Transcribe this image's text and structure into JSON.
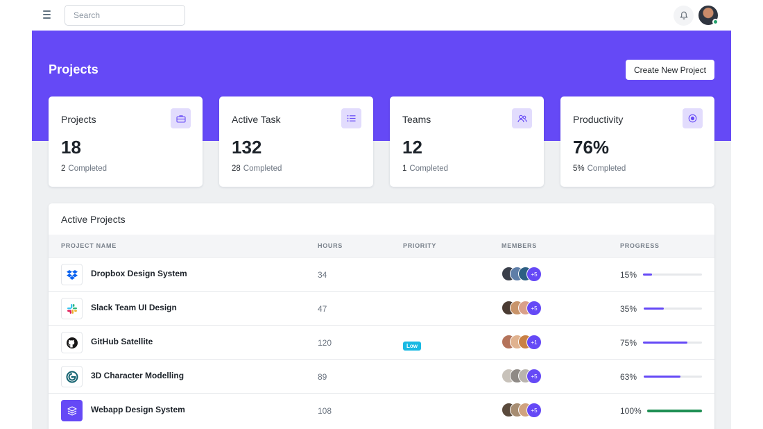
{
  "topbar": {
    "search_placeholder": "Search"
  },
  "header": {
    "title": "Projects",
    "create_button": "Create New Project"
  },
  "stats": [
    {
      "title": "Projects",
      "value": "18",
      "completed_count": "2",
      "completed_label": "Completed",
      "icon": "briefcase-icon"
    },
    {
      "title": "Active Task",
      "value": "132",
      "completed_count": "28",
      "completed_label": "Completed",
      "icon": "list-icon"
    },
    {
      "title": "Teams",
      "value": "12",
      "completed_count": "1",
      "completed_label": "Completed",
      "icon": "users-icon"
    },
    {
      "title": "Productivity",
      "value": "76%",
      "completed_count": "5%",
      "completed_label": "Completed",
      "icon": "target-icon"
    }
  ],
  "table": {
    "title": "Active Projects",
    "columns": [
      "PROJECT NAME",
      "HOURS",
      "PRIORITY",
      "MEMBERS",
      "PROGRESS"
    ],
    "rows": [
      {
        "name": "Dropbox Design System",
        "hours": "34",
        "priority": "",
        "members_more": "+5",
        "progress_label": "15%",
        "progress": 0.15,
        "logo": "dropbox-logo-icon"
      },
      {
        "name": "Slack Team UI Design",
        "hours": "47",
        "priority": "",
        "members_more": "+5",
        "progress_label": "35%",
        "progress": 0.35,
        "logo": "slack-logo-icon"
      },
      {
        "name": "GitHub Satellite",
        "hours": "120",
        "priority": "Low",
        "members_more": "+1",
        "progress_label": "75%",
        "progress": 0.75,
        "logo": "github-logo-icon"
      },
      {
        "name": "3D Character Modelling",
        "hours": "89",
        "priority": "",
        "members_more": "+5",
        "progress_label": "63%",
        "progress": 0.63,
        "logo": "spiral-logo-icon"
      },
      {
        "name": "Webapp Design System",
        "hours": "108",
        "priority": "",
        "members_more": "+5",
        "progress_label": "100%",
        "progress": 1.0,
        "logo": "layers-logo-icon"
      }
    ]
  },
  "colors": {
    "accent": "#6549f6",
    "success": "#1f8f54",
    "badge_low": "#19b9e3"
  }
}
